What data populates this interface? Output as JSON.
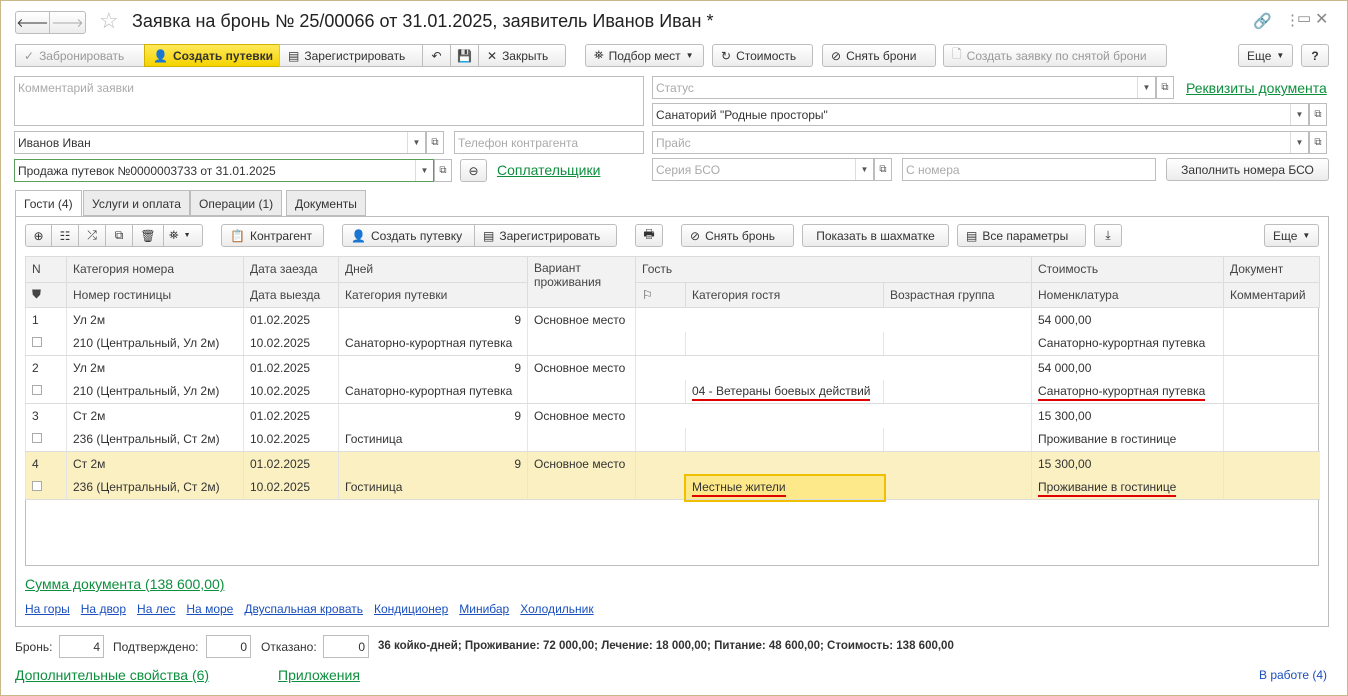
{
  "title": "Заявка на бронь № 25/00066 от 31.01.2025, заявитель Иванов Иван  *",
  "toolbar": {
    "book": "Забронировать",
    "create_vouchers": "Создать путевки",
    "register": "Зарегистрировать",
    "close": "Закрыть",
    "pick_places": "Подбор мест",
    "cost": "Стоимость",
    "cancel_booking": "Снять брони",
    "create_from_cancelled": "Создать заявку по снятой брони",
    "more": "Еще",
    "help": "?"
  },
  "form": {
    "comment_placeholder": "Комментарий заявки",
    "status_placeholder": "Статус",
    "requisites_link": "Реквизиты документа",
    "sanatorium": "Санаторий \"Родные просторы\"",
    "client": "Иванов Иван",
    "phone_placeholder": "Телефон контрагента",
    "price_placeholder": "Прайс",
    "sale": "Продажа путевок №0000003733 от 31.01.2025",
    "copayers_link": "Соплательщики",
    "bso_series_placeholder": "Серия БСО",
    "from_number_placeholder": "С номера",
    "fill_bso": "Заполнить номера БСО"
  },
  "tabs": [
    {
      "label": "Гости (4)"
    },
    {
      "label": "Услуги и оплата"
    },
    {
      "label": "Операции (1)"
    },
    {
      "label": "Документы"
    }
  ],
  "guests_toolbar": {
    "counterparty": "Контрагент",
    "create_voucher": "Создать путевку",
    "register": "Зарегистрировать",
    "cancel_booking": "Снять бронь",
    "show_chess": "Показать в шахматке",
    "all_params": "Все параметры",
    "more": "Еще"
  },
  "table": {
    "headers_top": [
      "N",
      "Категория номера",
      "Дата заезда",
      "Дней",
      "Вариант проживания",
      "Гость",
      "Стоимость",
      "Документ"
    ],
    "headers_bottom": [
      "Номер гостиницы",
      "Дата выезда",
      "Категория путевки",
      "Категория гостя",
      "Возрастная группа",
      "Номенклатура",
      "Комментарий"
    ],
    "rows": [
      {
        "n": "1",
        "room_cat": "Ул 2м",
        "arrival": "01.02.2025",
        "days": "9",
        "variant": "Основное место",
        "cost": "54 000,00",
        "room": "210 (Центральный, Ул 2м)",
        "departure": "10.02.2025",
        "voucher_cat": "Санаторно-курортная путевка",
        "guest_cat": "",
        "nomenclature": "Санаторно-курортная путевка"
      },
      {
        "n": "2",
        "room_cat": "Ул 2м",
        "arrival": "01.02.2025",
        "days": "9",
        "variant": "Основное место",
        "cost": "54 000,00",
        "room": "210 (Центральный, Ул 2м)",
        "departure": "10.02.2025",
        "voucher_cat": "Санаторно-курортная путевка",
        "guest_cat": "04 - Ветераны боевых действий",
        "nomenclature": "Санаторно-курортная путевка"
      },
      {
        "n": "3",
        "room_cat": "Ст 2м",
        "arrival": "01.02.2025",
        "days": "9",
        "variant": "Основное место",
        "cost": "15 300,00",
        "room": "236 (Центральный, Ст 2м)",
        "departure": "10.02.2025",
        "voucher_cat": "Гостиница",
        "guest_cat": "",
        "nomenclature": "Проживание в гостинице"
      },
      {
        "n": "4",
        "room_cat": "Ст 2м",
        "arrival": "01.02.2025",
        "days": "9",
        "variant": "Основное место",
        "cost": "15 300,00",
        "room": "236 (Центральный, Ст 2м)",
        "departure": "10.02.2025",
        "voucher_cat": "Гостиница",
        "guest_cat": "Местные жители",
        "nomenclature": "Проживание в гостинице"
      }
    ]
  },
  "doc_sum": "Сумма документа (138 600,00)",
  "tags": [
    "На горы",
    "На двор",
    "На лес",
    "На море",
    "Двуспальная кровать",
    "Кондиционер",
    "Минибар",
    "Холодильник"
  ],
  "footer": {
    "booked_label": "Бронь:",
    "booked": "4",
    "confirmed_label": "Подтверждено:",
    "confirmed": "0",
    "refused_label": "Отказано:",
    "refused": "0",
    "summary": "36 койко-дней; Проживание: 72 000,00; Лечение: 18 000,00; Питание: 48 600,00; Стоимость: 138 600,00",
    "extra_props": "Дополнительные свойства (6)",
    "attachments": "Приложения",
    "status": "В работе (4)"
  },
  "colors": {
    "accent_yellow": "#f5d400",
    "link_green": "#0d8f3e",
    "highlight_row": "#fbf0c2",
    "underline_red": "#e00000"
  }
}
